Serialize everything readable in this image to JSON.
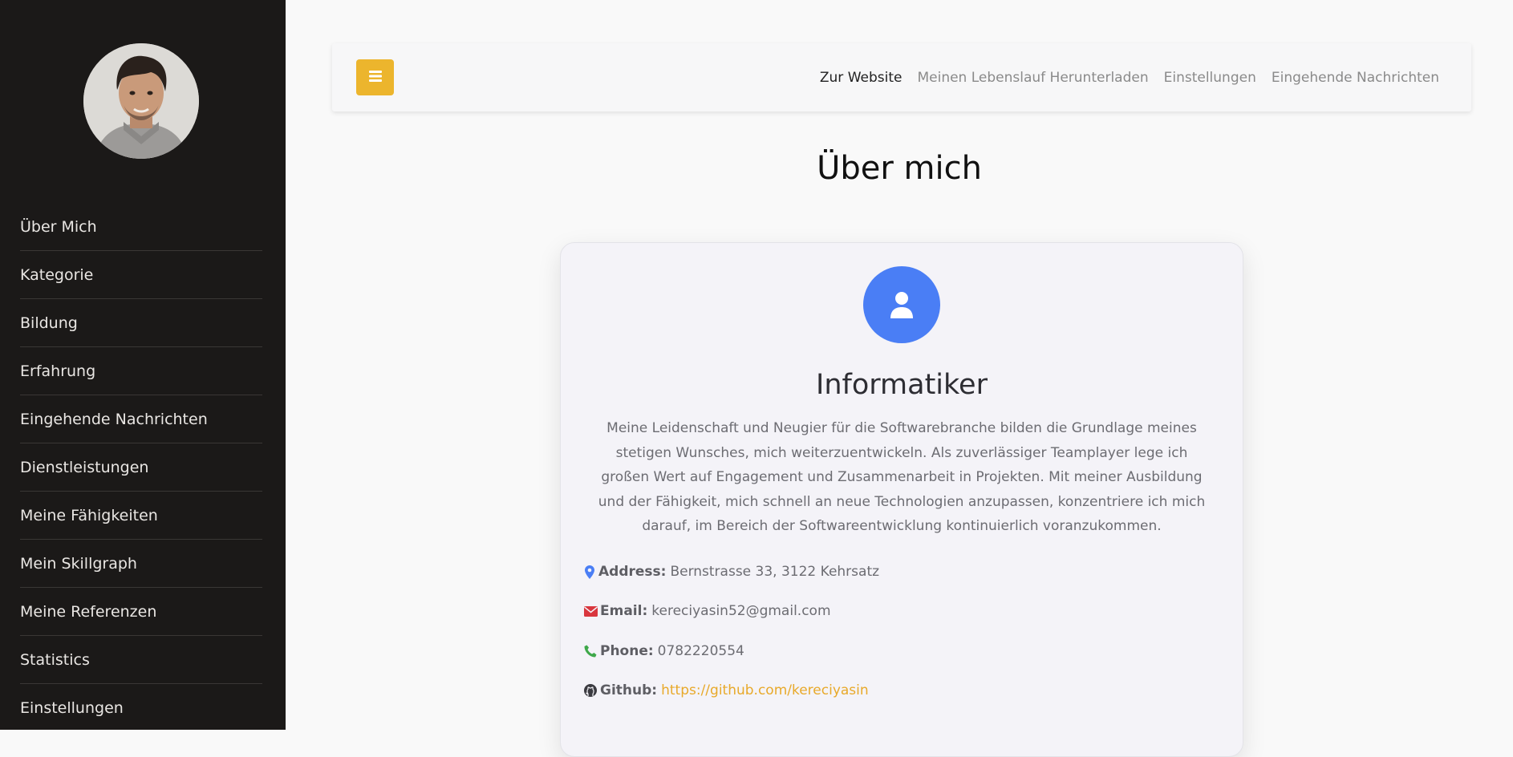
{
  "sidebar": {
    "items": [
      {
        "label": "Über Mich"
      },
      {
        "label": "Kategorie"
      },
      {
        "label": "Bildung"
      },
      {
        "label": "Erfahrung"
      },
      {
        "label": "Eingehende Nachrichten"
      },
      {
        "label": "Dienstleistungen"
      },
      {
        "label": "Meine Fähigkeiten"
      },
      {
        "label": "Mein Skillgraph"
      },
      {
        "label": "Meine Referenzen"
      },
      {
        "label": "Statistics"
      },
      {
        "label": "Einstellungen"
      }
    ]
  },
  "topbar": {
    "links": [
      {
        "label": "Zur Website"
      },
      {
        "label": "Meinen Lebenslauf Herunterladen"
      },
      {
        "label": "Einstellungen"
      },
      {
        "label": "Eingehende Nachrichten"
      }
    ]
  },
  "page": {
    "title": "Über mich"
  },
  "profile": {
    "title": "Informatiker",
    "description": "Meine Leidenschaft und Neugier für die Softwarebranche bilden die Grundlage meines stetigen Wunsches, mich weiterzuentwickeln. Als zuverlässiger Teamplayer lege ich großen Wert auf Engagement und Zusammenarbeit in Projekten. Mit meiner Ausbildung und der Fähigkeit, mich schnell an neue Technologien anzupassen, konzentriere ich mich darauf, im Bereich der Softwareentwicklung kontinuierlich voranzukommen.",
    "address": {
      "label": "Address:",
      "value": "Bernstrasse 33, 3122 Kehrsatz",
      "icon": "map-marker-icon",
      "color": "#4a7ef5"
    },
    "email": {
      "label": "Email:",
      "value": "kereciyasin52@gmail.com",
      "icon": "envelope-icon",
      "color": "#d9363e"
    },
    "phone": {
      "label": "Phone:",
      "value": "0782220554",
      "icon": "phone-icon",
      "color": "#3ea84a"
    },
    "github": {
      "label": "Github:",
      "value": "https://github.com/kereciyasin",
      "icon": "github-icon",
      "color": "#e8a92a"
    }
  },
  "colors": {
    "sidebar_bg": "#1b1918",
    "accent": "#ecb52d",
    "profile_icon_bg": "#4a7ef5"
  }
}
